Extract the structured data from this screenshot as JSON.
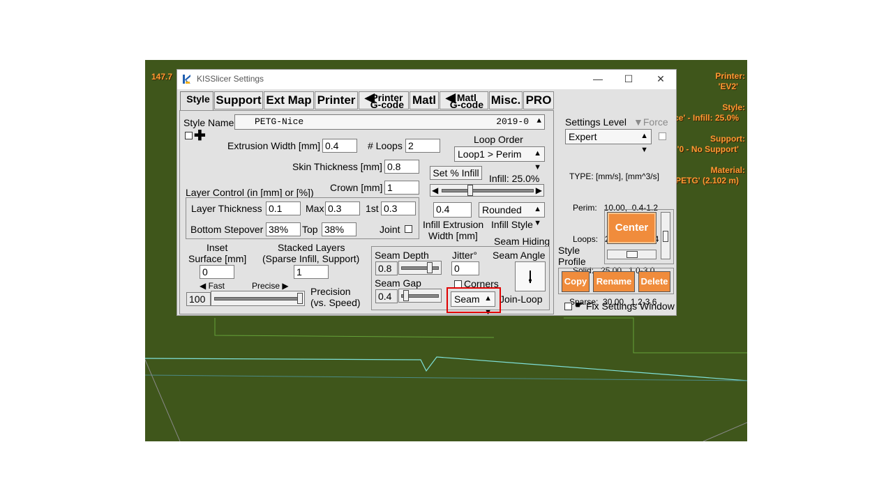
{
  "overlay": {
    "left_num": "147.7",
    "printer_label": "Printer:",
    "printer_value": "'EV2'",
    "style_label": "Style:",
    "style_value": "ce' - Infill: 25.0%",
    "support_label": "Support:",
    "support_value": "'0 - No Support'",
    "material_label": "Material:",
    "material_value": "PETG' (2.102 m)"
  },
  "window": {
    "title": "KISSlicer Settings",
    "minimize": "—",
    "maximize": "☐",
    "close": "✕"
  },
  "tabs": {
    "style": "Style",
    "support": "Support",
    "extmap": "Ext Map",
    "printer": "Printer",
    "printer_gcode_1": "Printer",
    "printer_gcode_2": "G-code",
    "matl": "Matl",
    "matl_gcode_1": "Matl",
    "matl_gcode_2": "G-code",
    "misc": "Misc.",
    "pro": "PRO"
  },
  "style": {
    "name_label": "Style Name",
    "name_value": "PETG-Nice",
    "name_date": "2019-0",
    "extrusion_width_label": "Extrusion Width [mm]",
    "extrusion_width": "0.4",
    "loops_label": "# Loops",
    "loops": "2",
    "loop_order_label": "Loop Order",
    "loop_order": "Loop1 > Perim",
    "skin_thickness_label": "Skin Thickness [mm]",
    "skin_thickness": "0.8",
    "set_infill_button": "Set % Infill",
    "infill_label": "Infill: 25.0%",
    "infill_fraction": 0.25,
    "crown_label": "Crown [mm]",
    "crown": "1",
    "layer_control_label": "Layer Control (in [mm] or [%])",
    "layer_thickness_label": "Layer Thickness",
    "layer_thickness": "0.1",
    "max_label": "Max",
    "max": "0.3",
    "first_label": "1st",
    "first": "0.3",
    "bottom_stepover_label": "Bottom Stepover",
    "bottom_stepover": "38%",
    "top_label": "Top",
    "top": "38%",
    "joint_label": "Joint",
    "infill_width": "0.4",
    "infill_width_label_1": "Infill Extrusion",
    "infill_width_label_2": "Width [mm]",
    "infill_style": "Rounded",
    "infill_style_label": "Infill Style",
    "inset_label_1": "Inset",
    "inset_label_2": "Surface [mm]",
    "inset": "0",
    "stacked_label_1": "Stacked Layers",
    "stacked_label_2": "(Sparse Infill, Support)",
    "stacked": "1",
    "fast_label": "Fast",
    "precise_label": "Precise",
    "precision_value": "100",
    "precision_fraction": 1.0,
    "precision_label_1": "Precision",
    "precision_label_2": "(vs. Speed)",
    "seam_hiding_label": "Seam Hiding",
    "seam_depth_label": "Seam Depth",
    "seam_depth": "0.8",
    "jitter_label": "Jitter°",
    "jitter": "0",
    "seam_angle_label": "Seam Angle",
    "seam_gap_label": "Seam Gap",
    "seam_gap": "0.4",
    "corners_label": "Corners",
    "seam_select": "Seam",
    "join_loop_label": "Join-Loop"
  },
  "right": {
    "settings_level_label": "Settings Level",
    "force_label": "Force",
    "level": "Expert",
    "speeds": [
      "TYPE: [mm/s], [mm^3/s]",
      "Perim:   10.00,  0.4-1.2",
      "Loops:   20.00,  0.8-2.4",
      "Solid:   25.00,  1.0-3.0",
      "Sparse:  30.00,  1.2-3.6"
    ],
    "style_profile_label_1": "Style",
    "style_profile_label_2": "Profile",
    "center_button": "Center",
    "copy_button": "Copy",
    "rename_button": "Rename",
    "delete_button": "Delete",
    "fix_label": "Fix Settings Window"
  },
  "colors": {
    "viewport_bg": "#3f561b",
    "accent_orange": "#f08c3c",
    "overlay_text": "#ff9933",
    "highlight": "#e00000"
  }
}
